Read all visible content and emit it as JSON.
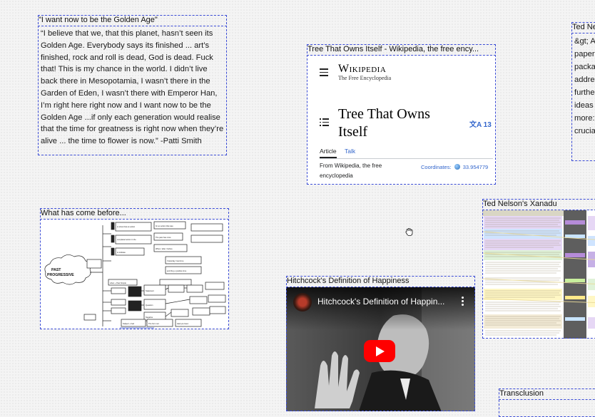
{
  "quote_card": {
    "title": "\"I want now to be the Golden Age\"",
    "body": "“I believe that we, that this planet, hasn’t seen its Golden Age. Everybody says its finished ... art’s finished, rock and roll is dead, God is dead. Fuck that! This is my chance in the world. I didn’t live back there in Mesopotamia, I wasn’t there in the Garden of Eden, I wasn’t there with Emperor Han, I’m right here right now and I want now to be the Golden Age ...if only each generation would realise that the time for greatness is right now when they’re alive ... the time to flower is now.” -Patti Smith"
  },
  "wiki_card": {
    "title": "Tree That Owns Itself - Wikipedia, the free ency...",
    "logo_word": "Wikipedia",
    "logo_sub": "The Free Encyclopedia",
    "article_title": "Tree That Owns Itself",
    "lang_count": "13",
    "tab_article": "Article",
    "tab_talk": "Talk",
    "from_text": "From Wikipedia, the free encyclopedia",
    "coords_label": "Coordinates:",
    "coords_value": "33.954779"
  },
  "diagram_card": {
    "title": "What has come before...",
    "center_label_1": "PAST",
    "center_label_2": "PROGRESSIVE"
  },
  "video_card": {
    "title": "Hitchcock's Definition of Happiness",
    "video_title": "Hitchcock's Definition of Happin..."
  },
  "xanadu_card": {
    "title": "Ted Nelson's Xanadu"
  },
  "ted_snippet_card": {
    "title": "Ted Ne",
    "lines": [
      "&gt; A",
      "paper",
      "packa",
      "addre",
      "furthe",
      "ideas",
      "more:",
      "crucia"
    ]
  },
  "transclusion_card": {
    "title": "Transclusion"
  },
  "colors": {
    "dashed_border": "#3a4bd6",
    "link": "#3366cc",
    "youtube_red": "#ff0000"
  }
}
